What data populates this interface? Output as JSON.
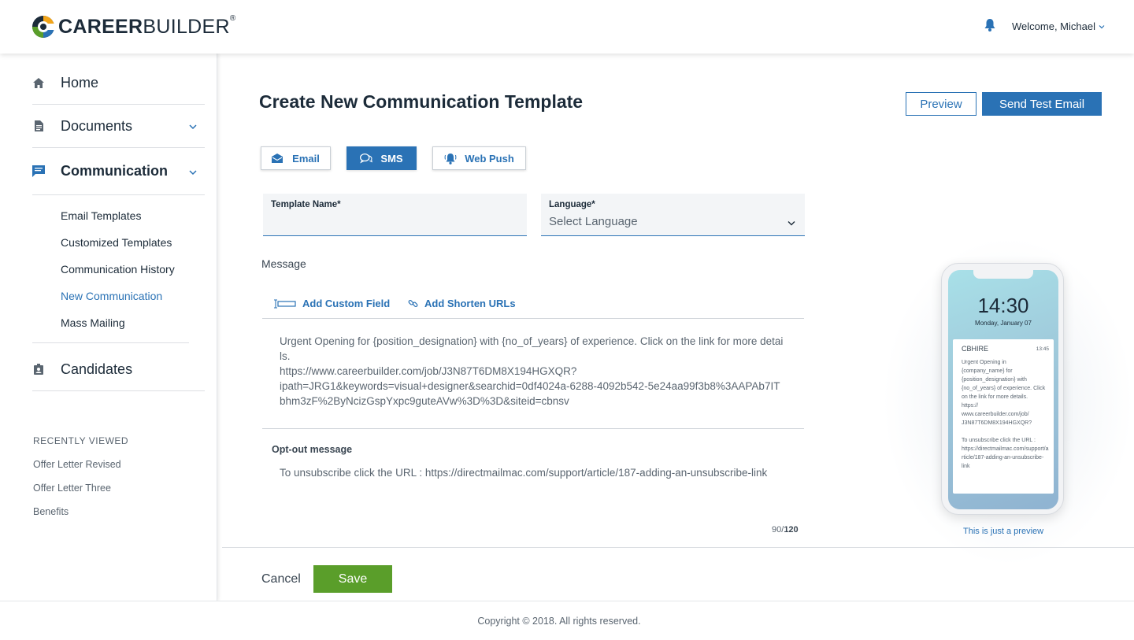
{
  "header": {
    "logo_bold": "CAREER",
    "logo_rest": "BUILDER",
    "logo_reg": "®",
    "welcome": "Welcome, Michael"
  },
  "sidebar": {
    "main": [
      {
        "label": "Home",
        "icon": "home-icon"
      },
      {
        "label": "Documents",
        "icon": "document-icon"
      },
      {
        "label": "Communication",
        "icon": "chat-icon"
      },
      {
        "label": "Candidates",
        "icon": "badge-icon"
      }
    ],
    "sub": [
      {
        "label": "Email Templates"
      },
      {
        "label": "Customized Templates"
      },
      {
        "label": "Communication History"
      },
      {
        "label": "New Communication"
      },
      {
        "label": "Mass Mailing"
      }
    ],
    "recent_title": "RECENTLY VIEWED",
    "recent": [
      {
        "label": "Offer Letter Revised"
      },
      {
        "label": "Offer Letter Three"
      },
      {
        "label": "Benefits"
      }
    ]
  },
  "main": {
    "title": "Create New Communication Template",
    "preview_label": "Preview",
    "test_email_label": "Send Test Email",
    "tabs": [
      {
        "label": "Email",
        "icon": "envelope-icon"
      },
      {
        "label": "SMS",
        "icon": "chat-bubbles-icon"
      },
      {
        "label": "Web Push",
        "icon": "bell-icon"
      }
    ],
    "template_name_label": "Template Name*",
    "template_name_value": "",
    "language_label": "Language*",
    "language_value": "Select Language",
    "message_label": "Message",
    "add_custom_field": "Add Custom Field",
    "add_shorten_urls": "Add Shorten URLs",
    "message_body": "Urgent Opening for {position_designation} with {no_of_years} of experience. Click on the link for more details.\nhttps://www.careerbuilder.com/job/J3N87T6DM8X194HGXQR?\nipath=JRG1&keywords=visual+designer&searchid=0df4024a-6288-4092b542-5e24aa99f3b8%3AAPAb7ITbhm3zF%2ByNcizGspYxpc9guteAVw%3D%3D&siteid=cbnsv",
    "optout_label": "Opt-out message",
    "optout_body": "To unsubscribe click the URL : https://directmailmac.com/support/article/187-adding-an-unsubscribe-link",
    "counter_current": "90",
    "counter_sep": "/",
    "counter_max": "120",
    "cancel_label": "Cancel",
    "save_label": "Save"
  },
  "phone": {
    "time": "14:30",
    "date": "Monday, January 07",
    "notif_from": "CBHIRE",
    "notif_time": "13:45",
    "notif_body": "Urgent Opening in {company_name} for {position_designation} with {no_of_years} of experience. Click on the link for more details.\nhttps://\nwww.careerbuilder.com/job/\nJ3N87T6DM8X194HGXQR?\n\nTo unsubscribe click the URL : https://directmailmac.com/support/article/187-adding-an-unsubscribe-link",
    "note": "This is just a preview"
  },
  "footer": {
    "copyright": "Copyright © 2018. All rights reserved."
  },
  "colors": {
    "accent": "#2a72b5",
    "save": "#5a9e2a",
    "text": "#1c2b39"
  }
}
